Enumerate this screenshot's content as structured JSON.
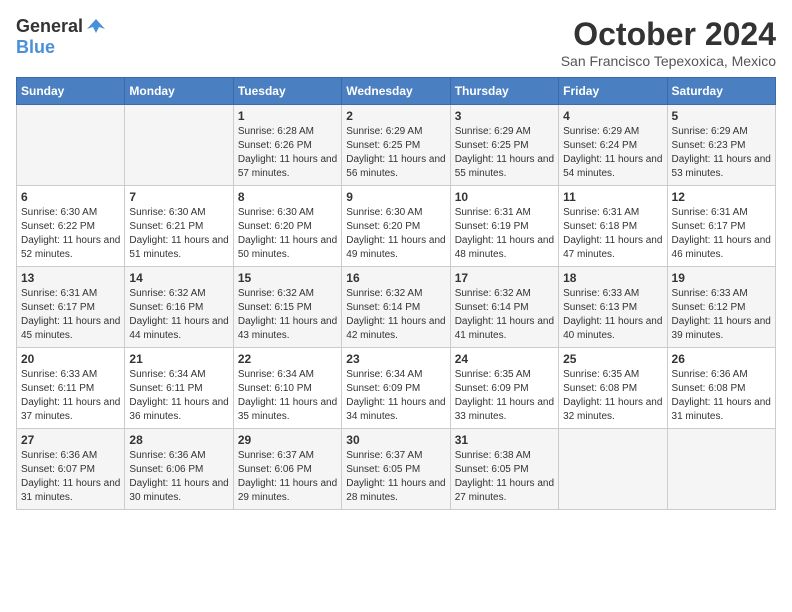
{
  "logo": {
    "general": "General",
    "blue": "Blue"
  },
  "header": {
    "month_title": "October 2024",
    "subtitle": "San Francisco Tepexoxica, Mexico"
  },
  "days_of_week": [
    "Sunday",
    "Monday",
    "Tuesday",
    "Wednesday",
    "Thursday",
    "Friday",
    "Saturday"
  ],
  "weeks": [
    [
      {
        "day": "",
        "info": ""
      },
      {
        "day": "",
        "info": ""
      },
      {
        "day": "1",
        "info": "Sunrise: 6:28 AM\nSunset: 6:26 PM\nDaylight: 11 hours and 57 minutes."
      },
      {
        "day": "2",
        "info": "Sunrise: 6:29 AM\nSunset: 6:25 PM\nDaylight: 11 hours and 56 minutes."
      },
      {
        "day": "3",
        "info": "Sunrise: 6:29 AM\nSunset: 6:25 PM\nDaylight: 11 hours and 55 minutes."
      },
      {
        "day": "4",
        "info": "Sunrise: 6:29 AM\nSunset: 6:24 PM\nDaylight: 11 hours and 54 minutes."
      },
      {
        "day": "5",
        "info": "Sunrise: 6:29 AM\nSunset: 6:23 PM\nDaylight: 11 hours and 53 minutes."
      }
    ],
    [
      {
        "day": "6",
        "info": "Sunrise: 6:30 AM\nSunset: 6:22 PM\nDaylight: 11 hours and 52 minutes."
      },
      {
        "day": "7",
        "info": "Sunrise: 6:30 AM\nSunset: 6:21 PM\nDaylight: 11 hours and 51 minutes."
      },
      {
        "day": "8",
        "info": "Sunrise: 6:30 AM\nSunset: 6:20 PM\nDaylight: 11 hours and 50 minutes."
      },
      {
        "day": "9",
        "info": "Sunrise: 6:30 AM\nSunset: 6:20 PM\nDaylight: 11 hours and 49 minutes."
      },
      {
        "day": "10",
        "info": "Sunrise: 6:31 AM\nSunset: 6:19 PM\nDaylight: 11 hours and 48 minutes."
      },
      {
        "day": "11",
        "info": "Sunrise: 6:31 AM\nSunset: 6:18 PM\nDaylight: 11 hours and 47 minutes."
      },
      {
        "day": "12",
        "info": "Sunrise: 6:31 AM\nSunset: 6:17 PM\nDaylight: 11 hours and 46 minutes."
      }
    ],
    [
      {
        "day": "13",
        "info": "Sunrise: 6:31 AM\nSunset: 6:17 PM\nDaylight: 11 hours and 45 minutes."
      },
      {
        "day": "14",
        "info": "Sunrise: 6:32 AM\nSunset: 6:16 PM\nDaylight: 11 hours and 44 minutes."
      },
      {
        "day": "15",
        "info": "Sunrise: 6:32 AM\nSunset: 6:15 PM\nDaylight: 11 hours and 43 minutes."
      },
      {
        "day": "16",
        "info": "Sunrise: 6:32 AM\nSunset: 6:14 PM\nDaylight: 11 hours and 42 minutes."
      },
      {
        "day": "17",
        "info": "Sunrise: 6:32 AM\nSunset: 6:14 PM\nDaylight: 11 hours and 41 minutes."
      },
      {
        "day": "18",
        "info": "Sunrise: 6:33 AM\nSunset: 6:13 PM\nDaylight: 11 hours and 40 minutes."
      },
      {
        "day": "19",
        "info": "Sunrise: 6:33 AM\nSunset: 6:12 PM\nDaylight: 11 hours and 39 minutes."
      }
    ],
    [
      {
        "day": "20",
        "info": "Sunrise: 6:33 AM\nSunset: 6:11 PM\nDaylight: 11 hours and 37 minutes."
      },
      {
        "day": "21",
        "info": "Sunrise: 6:34 AM\nSunset: 6:11 PM\nDaylight: 11 hours and 36 minutes."
      },
      {
        "day": "22",
        "info": "Sunrise: 6:34 AM\nSunset: 6:10 PM\nDaylight: 11 hours and 35 minutes."
      },
      {
        "day": "23",
        "info": "Sunrise: 6:34 AM\nSunset: 6:09 PM\nDaylight: 11 hours and 34 minutes."
      },
      {
        "day": "24",
        "info": "Sunrise: 6:35 AM\nSunset: 6:09 PM\nDaylight: 11 hours and 33 minutes."
      },
      {
        "day": "25",
        "info": "Sunrise: 6:35 AM\nSunset: 6:08 PM\nDaylight: 11 hours and 32 minutes."
      },
      {
        "day": "26",
        "info": "Sunrise: 6:36 AM\nSunset: 6:08 PM\nDaylight: 11 hours and 31 minutes."
      }
    ],
    [
      {
        "day": "27",
        "info": "Sunrise: 6:36 AM\nSunset: 6:07 PM\nDaylight: 11 hours and 31 minutes."
      },
      {
        "day": "28",
        "info": "Sunrise: 6:36 AM\nSunset: 6:06 PM\nDaylight: 11 hours and 30 minutes."
      },
      {
        "day": "29",
        "info": "Sunrise: 6:37 AM\nSunset: 6:06 PM\nDaylight: 11 hours and 29 minutes."
      },
      {
        "day": "30",
        "info": "Sunrise: 6:37 AM\nSunset: 6:05 PM\nDaylight: 11 hours and 28 minutes."
      },
      {
        "day": "31",
        "info": "Sunrise: 6:38 AM\nSunset: 6:05 PM\nDaylight: 11 hours and 27 minutes."
      },
      {
        "day": "",
        "info": ""
      },
      {
        "day": "",
        "info": ""
      }
    ]
  ]
}
